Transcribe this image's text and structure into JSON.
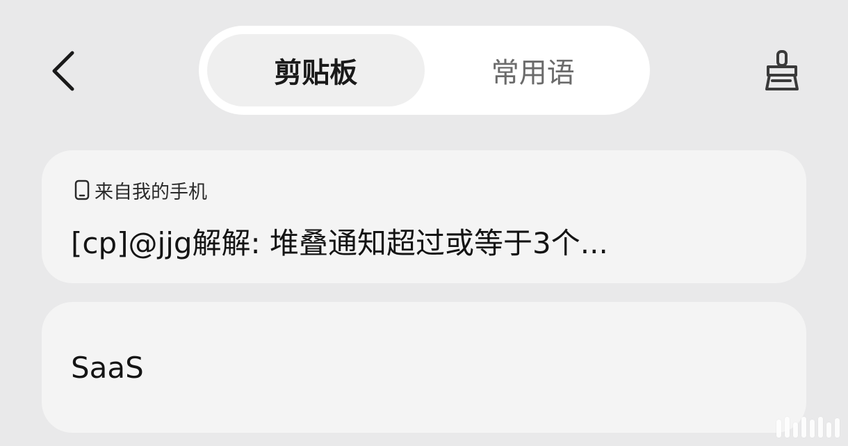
{
  "header": {
    "back_icon": "chevron-left-icon",
    "tabs": [
      {
        "label": "剪贴板",
        "active": true
      },
      {
        "label": "常用语",
        "active": false
      }
    ],
    "clean_icon": "broom-icon"
  },
  "clips": [
    {
      "source_icon": "phone-icon",
      "source_label": "来自我的手机",
      "text": "[cp]@jjg解解: 堆叠通知超过或等于3个..."
    },
    {
      "text": "SaaS"
    }
  ],
  "colors": {
    "background": "#e9e9ea",
    "card": "#f4f4f4",
    "active_tab": "#efefef",
    "inactive_text": "#6b6b6b"
  }
}
